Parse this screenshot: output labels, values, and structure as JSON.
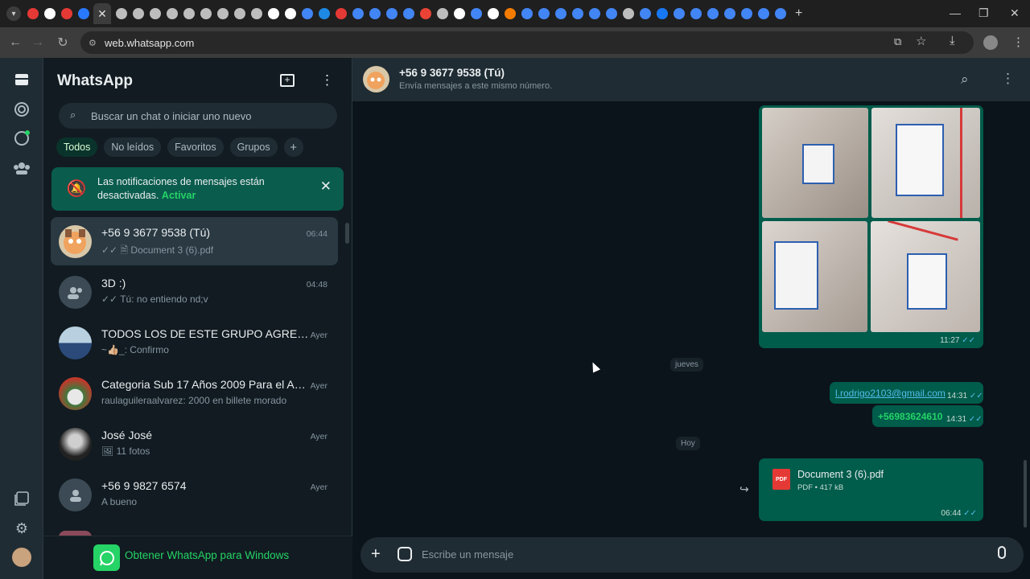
{
  "browser": {
    "url": "web.whatsapp.com",
    "close_tab_glyph": "✕",
    "new_tab_glyph": "+",
    "tab_favicon_colors": [
      "#e53935",
      "#ffffff",
      "#e53935",
      "#2979ff",
      "#bdbdbd",
      "#bdbdbd",
      "#bdbdbd",
      "#bdbdbd",
      "#bdbdbd",
      "#bdbdbd",
      "#bdbdbd",
      "#bdbdbd",
      "#bdbdbd",
      "#ffffff",
      "#ffffff",
      "#4285f4",
      "#1e88e5",
      "#e53935",
      "#4285f4",
      "#4285f4",
      "#4285f4",
      "#4285f4",
      "#ea4335",
      "#bdbdbd",
      "#ffffff",
      "#4285f4",
      "#ffffff",
      "#f57c00",
      "#4285f4",
      "#4285f4",
      "#4285f4",
      "#4285f4",
      "#4285f4",
      "#4285f4",
      "#bdbdbd",
      "#4285f4",
      "#1877f2",
      "#4285f4",
      "#4285f4",
      "#4285f4",
      "#4285f4",
      "#4285f4",
      "#4285f4",
      "#4285f4"
    ]
  },
  "sidebar": {
    "title": "WhatsApp",
    "search_placeholder": "Buscar un chat o iniciar uno nuevo",
    "filters": [
      "Todos",
      "No leídos",
      "Favoritos",
      "Grupos"
    ],
    "add_filter": "+",
    "notification": {
      "text": "Las notificaciones de mensajes están desactivadas.",
      "action": "Activar"
    },
    "chats": [
      {
        "name": "+56 9 3677 9538 (Tú)",
        "time": "06:44",
        "preview": "✓✓ 🗎 Document 3 (6).pdf"
      },
      {
        "name": "3D :)",
        "time": "04:48",
        "preview": "✓✓ Tú: no entiendo nd;v"
      },
      {
        "name": "TODOS LOS DE ESTE GRUPO AGREGAR A...",
        "time": "Ayer",
        "preview": "~👍🏼_: Confirmo"
      },
      {
        "name": "Categoria Sub 17 Años 2009 Para el Año ...",
        "time": "Ayer",
        "preview": "raulaguileraalvarez: 2000 en billete morado"
      },
      {
        "name": "José José",
        "time": "Ayer",
        "preview": "🖼 11 fotos"
      },
      {
        "name": "+56 9 9827 6574",
        "time": "Ayer",
        "preview": "A bueno"
      }
    ],
    "get_app": "Obtener WhatsApp para Windows"
  },
  "conversation": {
    "title": "+56 9 3677 9538 (Tú)",
    "subtitle": "Envía mensajes a este mismo número.",
    "photos_time": "11:27",
    "day_1": "jueves",
    "email_link": "l.rodrigo2103@gmail.com",
    "email_time": "14:31",
    "phone_link": "+56983624610",
    "phone_time": "14:31",
    "day_2": "Hoy",
    "document": {
      "name": "Document 3 (6).pdf",
      "meta": "PDF • 417 kB",
      "time": "06:44",
      "badge": "PDF"
    },
    "composer_placeholder": "Escribe un mensaje"
  },
  "colors": {
    "accent": "#25d366",
    "bubble_out": "#005c4b",
    "panel": "#111b21"
  }
}
